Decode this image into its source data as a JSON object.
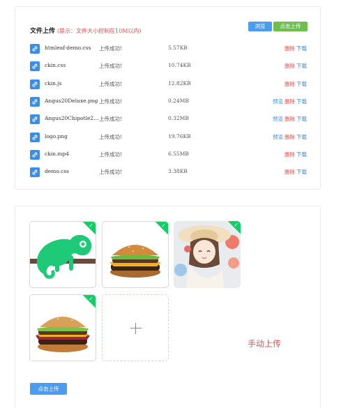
{
  "file_upload": {
    "title": "文件上传",
    "hint": "(提示：文件大小控制在10M以内)",
    "browse_label": "浏览",
    "upload_label": "点击上传",
    "files": [
      {
        "name": "htmleaf-demo.css",
        "status": "上传成功!",
        "size": "5.57KB",
        "preview": "",
        "delete": "删除",
        "download": "下载"
      },
      {
        "name": "ckin.css",
        "status": "上传成功!",
        "size": "10.74KB",
        "preview": "",
        "delete": "删除",
        "download": "下载"
      },
      {
        "name": "ckin.js",
        "status": "上传成功!",
        "size": "12.82KB",
        "preview": "",
        "delete": "删除",
        "download": "下载"
      },
      {
        "name": "Angus20Deluxe.png",
        "status": "上传成功!",
        "size": "0.24MB",
        "preview": "预览",
        "delete": "删除",
        "download": "下载"
      },
      {
        "name": "Angus20Chipotle20B…",
        "status": "上传成功!",
        "size": "0.32MB",
        "preview": "预览",
        "delete": "删除",
        "download": "下载"
      },
      {
        "name": "logo.png",
        "status": "上传成功!",
        "size": "19.76KB",
        "preview": "预览",
        "delete": "删除",
        "download": "下载"
      },
      {
        "name": "ckin.mp4",
        "status": "上传成功!",
        "size": "6.55MB",
        "preview": "",
        "delete": "删除",
        "download": "下载"
      },
      {
        "name": "demo.css",
        "status": "上传成功!",
        "size": "3.38KB",
        "preview": "",
        "delete": "删除",
        "download": "下载"
      }
    ]
  },
  "image_upload": {
    "manual_upload_text": "手动上传",
    "submit_label": "点击上传",
    "thumbnails": [
      "chameleon-logo",
      "burger-deluxe",
      "anime-girl",
      "burger-chipotle"
    ]
  },
  "colors": {
    "primary": "#4a9cf0",
    "success": "#6dc04d",
    "danger": "#e05050",
    "checked": "#13ce66"
  }
}
